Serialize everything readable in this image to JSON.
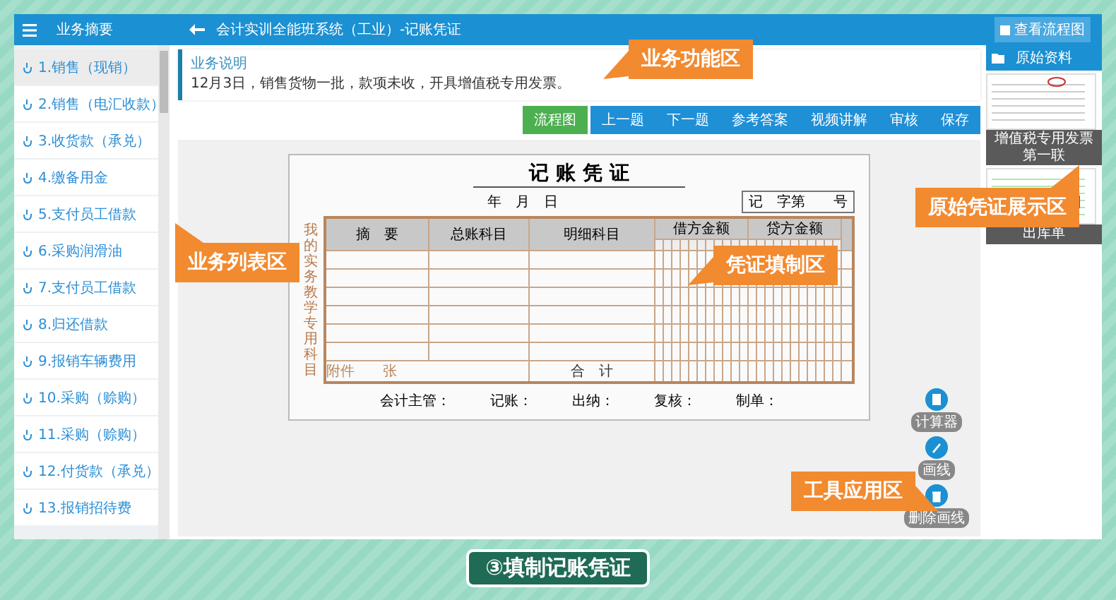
{
  "header": {
    "sidebar_title": "业务摘要",
    "title": "会计实训全能班系统（工业）-记账凭证",
    "flow_button": "查看流程图"
  },
  "sidebar": {
    "items": [
      {
        "label": "1.销售（现销）",
        "selected": true
      },
      {
        "label": "2.销售（电汇收款）",
        "selected": false
      },
      {
        "label": "3.收货款（承兑）",
        "selected": false
      },
      {
        "label": "4.缴备用金",
        "selected": false
      },
      {
        "label": "5.支付员工借款",
        "selected": false
      },
      {
        "label": "6.采购润滑油",
        "selected": false
      },
      {
        "label": "7.支付员工借款",
        "selected": false
      },
      {
        "label": "8.归还借款",
        "selected": false
      },
      {
        "label": "9.报销车辆费用",
        "selected": false
      },
      {
        "label": "10.采购（赊购）",
        "selected": false
      },
      {
        "label": "11.采购（赊购）",
        "selected": false
      },
      {
        "label": "12.付货款（承兑）",
        "selected": false
      },
      {
        "label": "13.报销招待费",
        "selected": false
      }
    ]
  },
  "description": {
    "title": "业务说明",
    "text": "12月3日，销售货物一批，款项未收，开具增值税专用发票。"
  },
  "toolbar": {
    "buttons": [
      {
        "label": "流程图",
        "kind": "flow"
      },
      {
        "label": "上一题",
        "kind": "nav"
      },
      {
        "label": "下一题",
        "kind": "nav"
      },
      {
        "label": "参考答案",
        "kind": "nav"
      },
      {
        "label": "视频讲解",
        "kind": "nav"
      },
      {
        "label": "审核",
        "kind": "nav"
      },
      {
        "label": "保存",
        "kind": "nav"
      }
    ]
  },
  "voucher": {
    "title": "记 账 凭 证",
    "date": "年　月　日",
    "number": "记　字第　　号",
    "side_label": "我的实务教学专用科目",
    "columns": [
      "摘　要",
      "总账科目",
      "明细科目",
      "借方金额",
      "贷方金额"
    ],
    "attachment": "附件",
    "attachment_unit": "张",
    "total": "合　计",
    "signatures": [
      "会计主管：",
      "记账：",
      "出纳：",
      "复核：",
      "制单："
    ]
  },
  "materials": {
    "title": "原始资料",
    "items": [
      {
        "caption": "增值税专用发票第一联"
      },
      {
        "caption": "出库单"
      }
    ]
  },
  "tools": [
    {
      "label": "计算器",
      "kind": "calculator"
    },
    {
      "label": "画线",
      "kind": "pen"
    },
    {
      "label": "删除画线",
      "kind": "delete"
    }
  ],
  "callouts": [
    {
      "label": "业务功能区",
      "kind": "function"
    },
    {
      "label": "业务列表区",
      "kind": "list"
    },
    {
      "label": "凭证填制区",
      "kind": "voucher"
    },
    {
      "label": "原始凭证展示区",
      "kind": "source"
    },
    {
      "label": "工具应用区",
      "kind": "tools"
    }
  ],
  "caption": "③填制记账凭证"
}
